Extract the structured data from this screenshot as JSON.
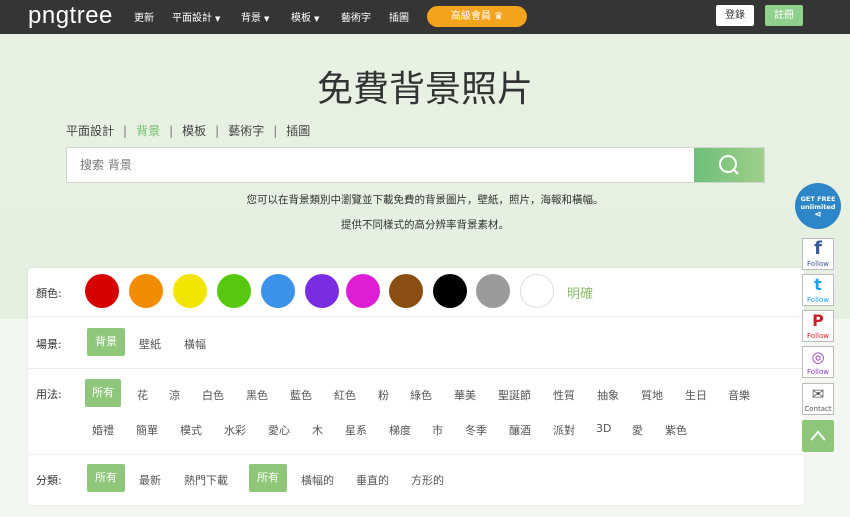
{
  "header": {
    "logo": "pngtree",
    "nav": [
      {
        "label": "更新",
        "caret": false
      },
      {
        "label": "平面設計",
        "caret": true
      },
      {
        "label": "背景",
        "caret": true
      },
      {
        "label": "模板",
        "caret": true
      },
      {
        "label": "藝術字",
        "caret": false
      },
      {
        "label": "插圖",
        "caret": false
      }
    ],
    "vip_label": "高級會員",
    "login_label": "登錄",
    "register_label": "註冊"
  },
  "hero": {
    "title": "免費背景照片",
    "categories": [
      {
        "label": "平面設計",
        "active": false
      },
      {
        "label": "背景",
        "active": true
      },
      {
        "label": "模板",
        "active": false
      },
      {
        "label": "藝術字",
        "active": false
      },
      {
        "label": "插圖",
        "active": false
      }
    ],
    "search_placeholder": "搜索 背景",
    "desc1": "您可以在背景類別中瀏覽並下載免費的背景圖片，壁紙，照片，海報和橫幅。",
    "desc2": "提供不同樣式的高分辨率背景素材。"
  },
  "filters": {
    "color_label": "顏色:",
    "colors": [
      "#d70000",
      "#f28c00",
      "#f2e600",
      "#56c80e",
      "#3c92e8",
      "#7a2de0",
      "#dd1ed4",
      "#8b4e12",
      "#000000",
      "#9b9b9b",
      "#ffffff"
    ],
    "clear_label": "明確",
    "scene_label": "場景:",
    "scenes": [
      {
        "label": "背景",
        "selected": true
      },
      {
        "label": "壁紙",
        "selected": false
      },
      {
        "label": "橫幅",
        "selected": false
      }
    ],
    "usage_label": "用法:",
    "usage_row1": [
      {
        "label": "所有",
        "selected": true
      },
      {
        "label": "花"
      },
      {
        "label": "涼"
      },
      {
        "label": "白色"
      },
      {
        "label": "黑色"
      },
      {
        "label": "藍色"
      },
      {
        "label": "紅色"
      },
      {
        "label": "粉"
      },
      {
        "label": "綠色"
      },
      {
        "label": "華美"
      },
      {
        "label": "聖誕節"
      },
      {
        "label": "性質"
      },
      {
        "label": "抽象"
      },
      {
        "label": "質地"
      },
      {
        "label": "生日"
      },
      {
        "label": "音樂"
      }
    ],
    "usage_row2": [
      {
        "label": "婚禮"
      },
      {
        "label": "簡單"
      },
      {
        "label": "模式"
      },
      {
        "label": "水彩"
      },
      {
        "label": "愛心"
      },
      {
        "label": "木"
      },
      {
        "label": "星系"
      },
      {
        "label": "梯度"
      },
      {
        "label": "市"
      },
      {
        "label": "冬季"
      },
      {
        "label": "釀酒"
      },
      {
        "label": "派對"
      },
      {
        "label": "3D"
      },
      {
        "label": "愛"
      },
      {
        "label": "紫色"
      }
    ],
    "category_label": "分類:",
    "categories": [
      {
        "label": "所有",
        "selected": true
      },
      {
        "label": "最新"
      },
      {
        "label": "熱門下載"
      },
      {
        "label": "所有",
        "selected": true
      },
      {
        "label": "橫幅的"
      },
      {
        "label": "垂直的"
      },
      {
        "label": "方形的"
      }
    ]
  },
  "social": {
    "badge_line1": "GET FREE",
    "badge_line2": "unlimited",
    "items": [
      {
        "glyph": "f",
        "label": "Follow",
        "color": "#3b5998"
      },
      {
        "glyph": "t",
        "label": "Follow",
        "color": "#1da1f2"
      },
      {
        "glyph": "P",
        "label": "Follow",
        "color": "#cb2027"
      },
      {
        "glyph": "◎",
        "label": "Follow",
        "color": "#8a3ab9"
      },
      {
        "glyph": "✉",
        "label": "Contact",
        "color": "#555555"
      }
    ]
  }
}
